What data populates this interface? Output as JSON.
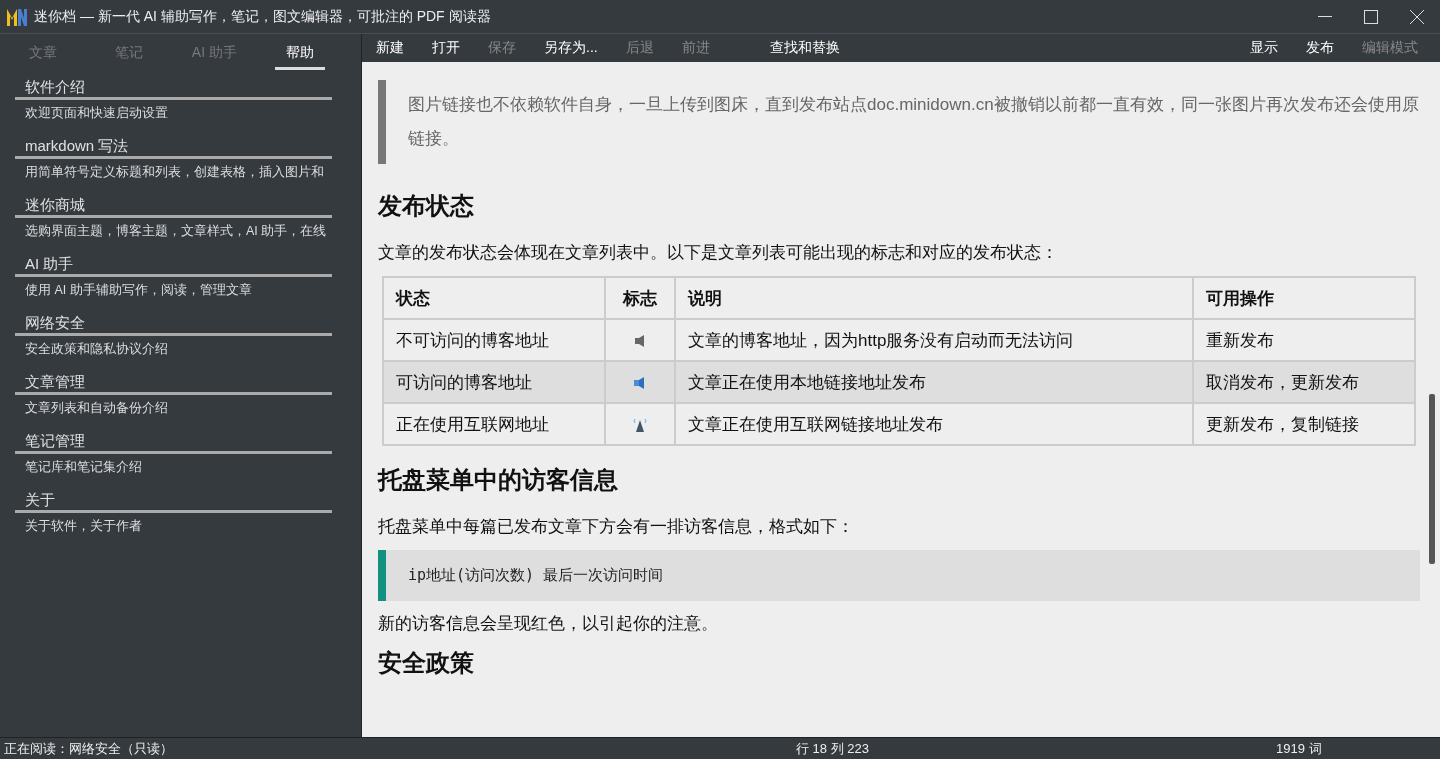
{
  "window": {
    "title": "迷你档 — 新一代 AI 辅助写作，笔记，图文编辑器，可批注的 PDF 阅读器"
  },
  "sidebar": {
    "tabs": [
      {
        "label": "文章",
        "selected": false
      },
      {
        "label": "笔记",
        "selected": false
      },
      {
        "label": "AI 助手",
        "selected": false
      },
      {
        "label": "帮助",
        "selected": true
      }
    ],
    "items": [
      {
        "title": "软件介绍",
        "description": "欢迎页面和快速启动设置"
      },
      {
        "title": "markdown 写法",
        "description": "用简单符号定义标题和列表，创建表格，插入图片和"
      },
      {
        "title": "迷你商城",
        "description": "选购界面主题，博客主题，文章样式，AI 助手，在线"
      },
      {
        "title": "AI 助手",
        "description": "使用 AI 助手辅助写作，阅读，管理文章"
      },
      {
        "title": "网络安全",
        "description": "安全政策和隐私协议介绍"
      },
      {
        "title": "文章管理",
        "description": "文章列表和自动备份介绍"
      },
      {
        "title": "笔记管理",
        "description": "笔记库和笔记集介绍"
      },
      {
        "title": "关于",
        "description": "关于软件，关于作者"
      }
    ]
  },
  "toolbar": {
    "left": [
      {
        "label": "新建",
        "disabled": false
      },
      {
        "label": "打开",
        "disabled": false
      },
      {
        "label": "保存",
        "disabled": true
      },
      {
        "label": "另存为...",
        "disabled": false
      },
      {
        "label": "后退",
        "disabled": true
      },
      {
        "label": "前进",
        "disabled": true
      },
      {
        "label": "查找和替换",
        "disabled": false
      }
    ],
    "right": [
      {
        "label": "显示",
        "disabled": false
      },
      {
        "label": "发布",
        "disabled": false
      },
      {
        "label": "编辑模式",
        "disabled": true
      }
    ]
  },
  "document": {
    "blocks": [
      {
        "kind": "quote",
        "text": "图片链接也不依赖软件自身，一旦上传到图床，直到发布站点doc.minidown.cn被撤销以前都一直有效，同一张图片再次发布还会使用原链接。"
      },
      {
        "kind": "heading",
        "text": "发布状态"
      },
      {
        "kind": "paragraph",
        "text": "文章的发布状态会体现在文章列表中。以下是文章列表可能出现的标志和对应的发布状态："
      },
      {
        "kind": "table",
        "columns": [
          "状态",
          "标志",
          "说明",
          "可用操作"
        ],
        "rows": [
          {
            "status": "不可访问的博客地址",
            "kind": "offline",
            "description": "文章的博客地址，因为http服务没有启动而无法访问",
            "actions": "重新发布",
            "selected": false
          },
          {
            "status": "可访问的博客地址",
            "kind": "local",
            "description": "文章正在使用本地链接地址发布",
            "actions": "取消发布，更新发布",
            "selected": true
          },
          {
            "status": "正在使用互联网地址",
            "kind": "internet",
            "description": "文章正在使用互联网链接地址发布",
            "actions": "更新发布，复制链接",
            "selected": false
          }
        ]
      },
      {
        "kind": "heading",
        "text": "托盘菜单中的访客信息"
      },
      {
        "kind": "paragraph",
        "text": "托盘菜单中每篇已发布文章下方会有一排访客信息，格式如下："
      },
      {
        "kind": "code",
        "text": "ip地址(访问次数) 最后一次访问时间"
      },
      {
        "kind": "paragraph",
        "text": "新的访客信息会呈现红色，以引起你的注意。"
      },
      {
        "kind": "heading",
        "text": "安全政策"
      }
    ]
  },
  "status_bar": {
    "left": "正在阅读：网络安全（只读）",
    "center": "行 18 列 223",
    "right": "1919 词"
  }
}
